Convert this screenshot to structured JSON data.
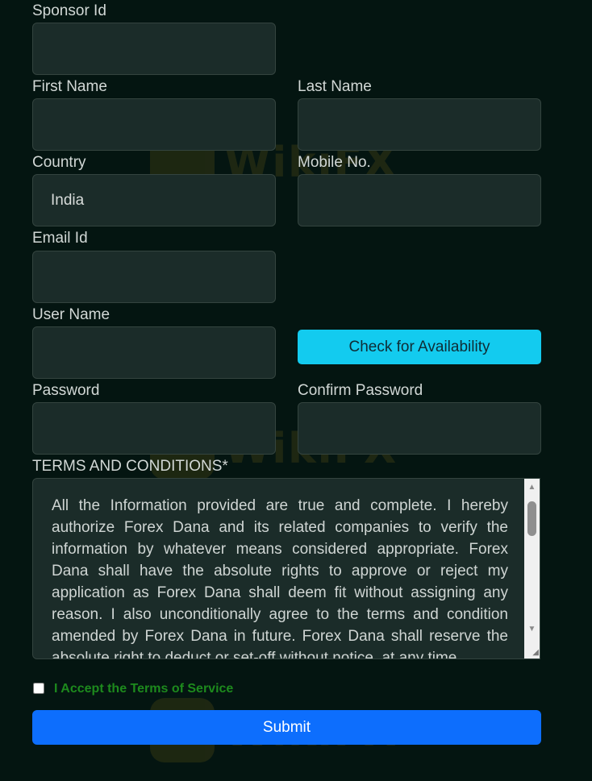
{
  "labels": {
    "sponsor_id": "Sponsor Id",
    "first_name": "First Name",
    "last_name": "Last Name",
    "country": "Country",
    "mobile": "Mobile No.",
    "email": "Email Id",
    "user_name": "User Name",
    "password": "Password",
    "confirm_password": "Confirm Password",
    "terms_heading": "TERMS AND CONDITIONS*"
  },
  "values": {
    "sponsor_id": "",
    "first_name": "",
    "last_name": "",
    "country": "India",
    "mobile": "",
    "email": "",
    "user_name": "",
    "password": "",
    "confirm_password": ""
  },
  "buttons": {
    "check_availability": "Check for Availability",
    "submit": "Submit"
  },
  "terms": {
    "text": "All the Information provided are true and complete. I hereby authorize Forex Dana and its related companies to verify the information by whatever means considered appropriate. Forex Dana shall have the absolute rights to approve or reject my application as Forex Dana shall deem fit without assigning any reason. I also unconditionally agree to the terms and condition amended by Forex Dana in future. Forex Dana shall reserve the absolute right to deduct or set-off without notice, at any time,",
    "accept_label": "I Accept the Terms of Service",
    "accepted": false
  },
  "watermark": {
    "text": "WikiFX",
    "color": "#c9a21a"
  },
  "colors": {
    "background": "#041511",
    "field_bg": "#1b2c29",
    "check_button": "#13cbef",
    "submit_button": "#0d6efd",
    "accept_text": "#1d8a1d"
  }
}
